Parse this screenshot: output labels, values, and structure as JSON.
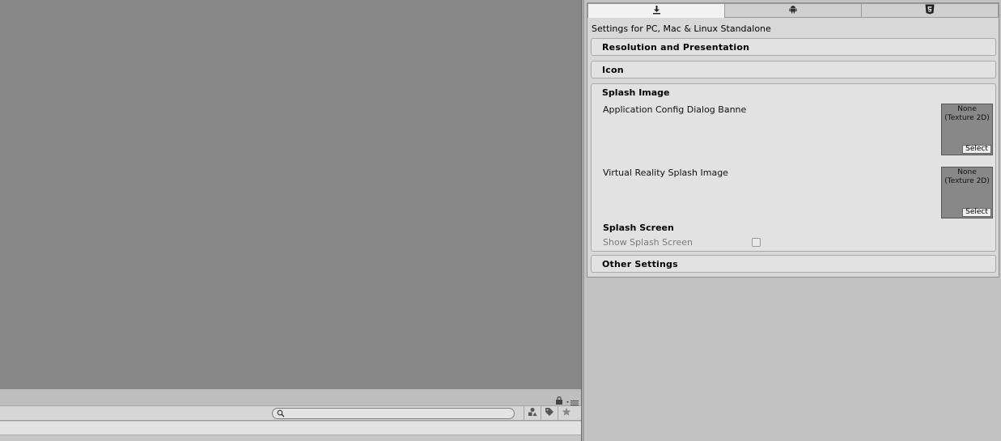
{
  "platform_tabs": [
    {
      "icon": "download-icon",
      "active": true
    },
    {
      "icon": "android-icon",
      "active": false
    },
    {
      "icon": "html5-icon",
      "active": false
    }
  ],
  "inspector": {
    "settings_for": "Settings for PC, Mac & Linux Standalone",
    "sections": {
      "resolution": "Resolution and Presentation",
      "icon": "Icon",
      "splash_image": "Splash Image",
      "other_settings": "Other Settings"
    },
    "splash": {
      "app_config_label": "Application Config Dialog Banne",
      "vr_splash_label": "Virtual Reality Splash Image",
      "texture_placeholder": "None (Texture 2D)",
      "select_label": "Select",
      "splash_screen_heading": "Splash Screen",
      "show_splash_label": "Show Splash Screen",
      "show_splash_checked": false
    }
  },
  "project_panel": {
    "search_value": "",
    "toolbar_icons": [
      "filter-by-type-icon",
      "filter-by-label-icon",
      "favorites-star-icon"
    ]
  },
  "colors": {
    "scene_bg": "#878787",
    "inspector_bg": "#d8d8d8",
    "window_bg": "#c2c2c2"
  }
}
